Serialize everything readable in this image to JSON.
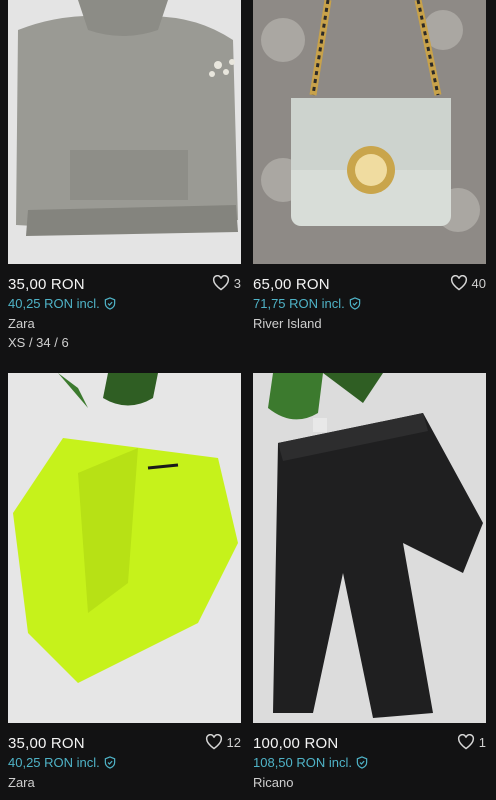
{
  "items": [
    {
      "price": "35,00 RON",
      "price_incl": "40,25 RON incl.",
      "brand": "Zara",
      "size": "XS / 34 / 6",
      "favorites": "3",
      "photo_icon": "grey-sweater-photo"
    },
    {
      "price": "65,00 RON",
      "price_incl": "71,75 RON incl.",
      "brand": "River Island",
      "size": "",
      "favorites": "40",
      "photo_icon": "white-quilted-bag-photo"
    },
    {
      "price": "35,00 RON",
      "price_incl": "40,25 RON incl.",
      "brand": "Zara",
      "size": "",
      "favorites": "12",
      "photo_icon": "neon-green-jacket-photo"
    },
    {
      "price": "100,00 RON",
      "price_incl": "108,50 RON incl.",
      "brand": "Ricano",
      "size": "",
      "favorites": "1",
      "photo_icon": "black-leather-pants-photo"
    }
  ],
  "colors": {
    "background": "#121213",
    "accent_incl": "#4fb3c7",
    "text_primary": "#f4f4f4",
    "text_secondary": "#cfcfcf"
  }
}
